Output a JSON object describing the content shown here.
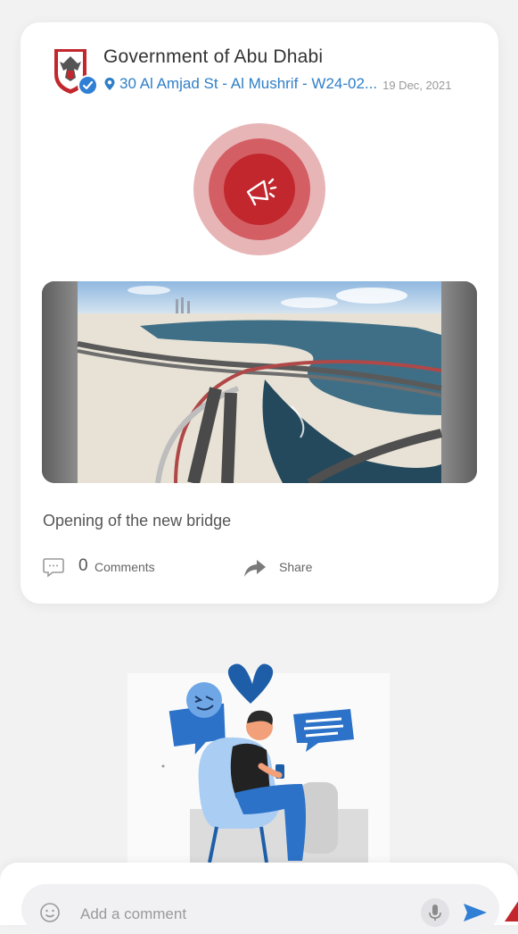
{
  "post": {
    "author": "Government of Abu Dhabi",
    "location": "30 Al Amjad St - Al Mushrif - W24-02...",
    "date": "19 Dec, 2021",
    "caption": "Opening of the new bridge",
    "comments_count": "0",
    "comments_label": "Comments",
    "share_label": "Share"
  },
  "composer": {
    "placeholder": "Add a comment"
  },
  "icons": {
    "avatar": "abu-dhabi-emblem",
    "verified": "verified-badge-icon",
    "location": "location-pin-icon",
    "announcement": "megaphone-icon",
    "comments": "comment-bubble-icon",
    "share": "share-arrow-icon",
    "emoji": "smiley-icon",
    "mic": "microphone-icon",
    "send": "send-icon"
  },
  "colors": {
    "accent_blue": "#2f7fc8",
    "announcement_red": "#c1272d",
    "background": "#f2f2f3"
  }
}
